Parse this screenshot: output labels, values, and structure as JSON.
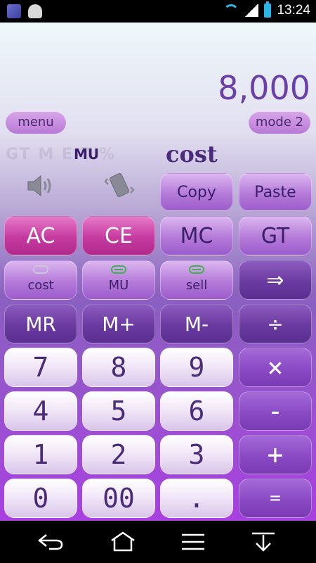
{
  "status_bar": {
    "time": "13:24"
  },
  "display": {
    "value": "8,000"
  },
  "top_pills": {
    "menu": "menu",
    "mode": "mode 2"
  },
  "indicators": {
    "faint": "GT M E  T %",
    "mu": "MU",
    "mode_text": "cost"
  },
  "buttons": {
    "copy": "Copy",
    "paste": "Paste",
    "ac": "AC",
    "ce": "CE",
    "mc": "MC",
    "gt": "GT",
    "cost": "cost",
    "mu": "MU",
    "sell": "sell",
    "arrow": "⇒",
    "mr": "MR",
    "mplus": "M+",
    "mminus": "M-",
    "divide": "÷",
    "n7": "7",
    "n8": "8",
    "n9": "9",
    "multiply": "×",
    "n4": "4",
    "n5": "5",
    "n6": "6",
    "minus": "-",
    "n1": "1",
    "n2": "2",
    "n3": "3",
    "plus": "+",
    "n0": "0",
    "n00": "00",
    "dot": ".",
    "equals": "="
  },
  "colors": {
    "accent": "#6a3fa8",
    "clear_button": "#c63aa0",
    "status_icon": "#2bb5e6"
  }
}
